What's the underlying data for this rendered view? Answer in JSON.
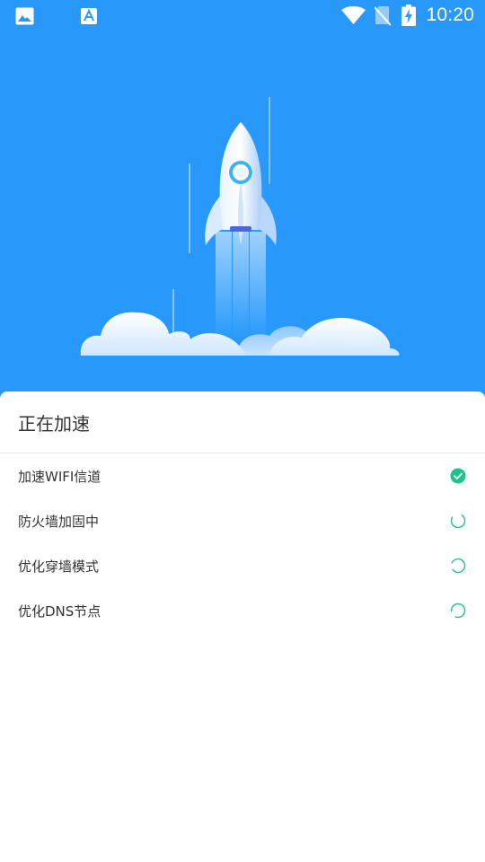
{
  "status_bar": {
    "time": "10:20",
    "icons": [
      "image-notification-icon",
      "text-a-notification-icon",
      "wifi-icon",
      "no-sim-icon",
      "battery-charging-icon"
    ]
  },
  "colors": {
    "hero_background": "#2899fb",
    "accent_green": "#1ec28b",
    "text_primary": "#333333"
  },
  "illustration": {
    "icons": [
      "rocket-icon",
      "cloud-icon"
    ]
  },
  "sheet": {
    "title": "正在加速",
    "tasks": [
      {
        "label": "加速WIFI信道",
        "status": "done"
      },
      {
        "label": "防火墙加固中",
        "status": "loading"
      },
      {
        "label": "优化穿墙模式",
        "status": "loading"
      },
      {
        "label": "优化DNS节点",
        "status": "loading"
      }
    ]
  }
}
